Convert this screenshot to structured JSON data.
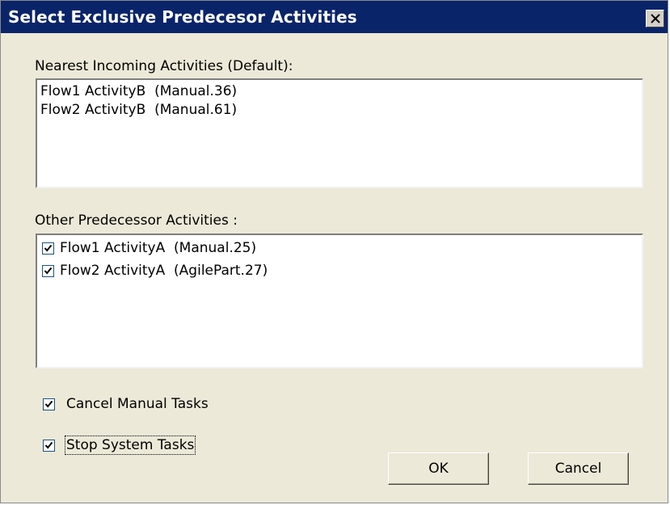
{
  "dialog": {
    "title": "Select Exclusive Predecesor Activities",
    "nearest_label": "Nearest Incoming Activities  (Default):",
    "nearest_items": [
      "Flow1 ActivityB  (Manual.36)",
      "Flow2 ActivityB  (Manual.61)"
    ],
    "other_label": "Other Predecessor Activities :",
    "other_items": [
      {
        "label": "Flow1 ActivityA  (Manual.25)",
        "checked": true
      },
      {
        "label": "Flow2 ActivityA  (AgilePart.27)",
        "checked": true
      }
    ],
    "cancel_manual_label": "Cancel Manual Tasks",
    "cancel_manual_checked": true,
    "stop_system_label": "Stop System Tasks",
    "stop_system_checked": true,
    "ok_label": "OK",
    "cancel_label": "Cancel"
  },
  "colors": {
    "titlebar": "#0a246a",
    "dialog_bg": "#ece9d8",
    "checkbox_border": "#1c5180"
  }
}
